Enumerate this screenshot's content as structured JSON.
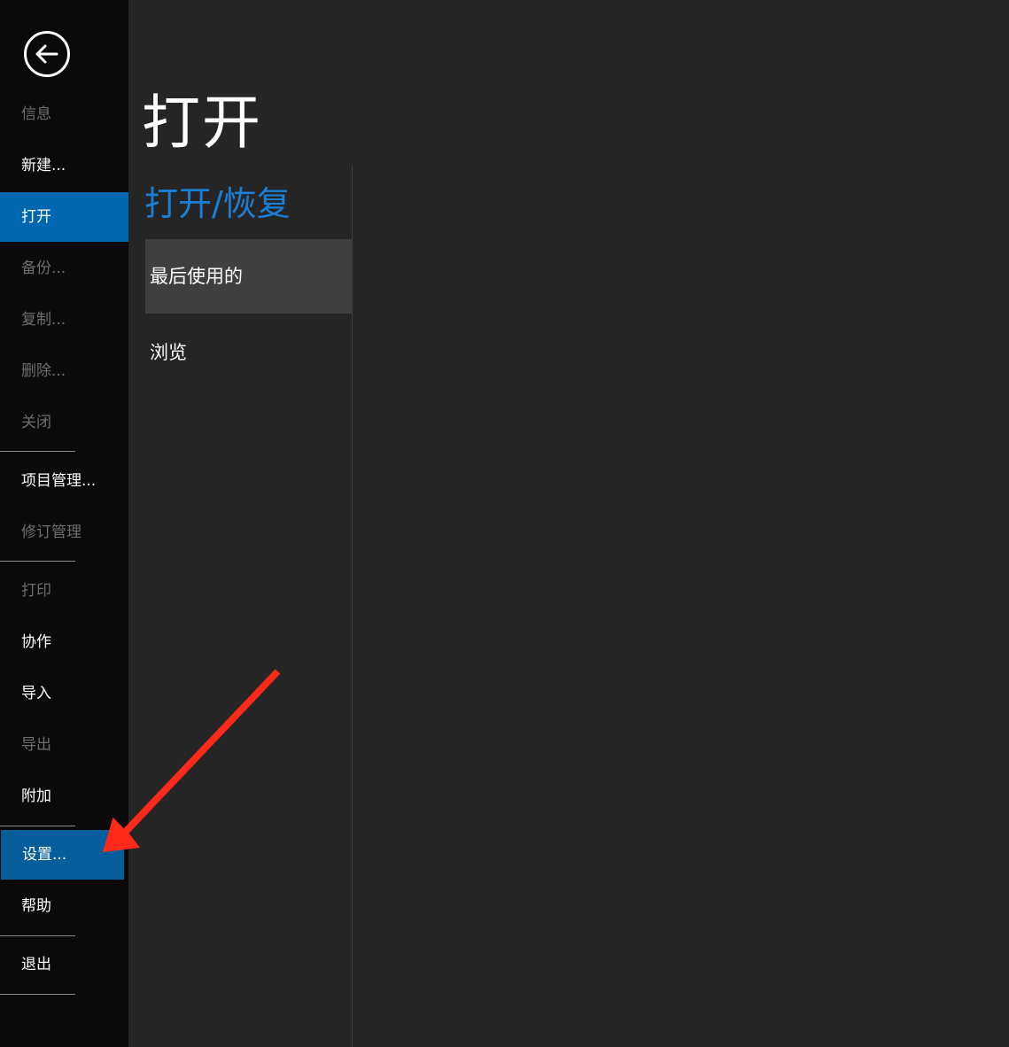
{
  "page_title": "打开",
  "section_title": "打开/恢复",
  "nav": {
    "back_label": "back",
    "items": [
      {
        "label": "信息",
        "state": "disabled"
      },
      {
        "label": "新建...",
        "state": "normal"
      },
      {
        "label": "打开",
        "state": "active"
      },
      {
        "label": "备份...",
        "state": "disabled"
      },
      {
        "label": "复制...",
        "state": "disabled"
      },
      {
        "label": "删除...",
        "state": "disabled"
      },
      {
        "label": "关闭",
        "state": "disabled"
      },
      {
        "label": "项目管理...",
        "state": "normal"
      },
      {
        "label": "修订管理",
        "state": "disabled"
      },
      {
        "label": "打印",
        "state": "disabled"
      },
      {
        "label": "协作",
        "state": "normal"
      },
      {
        "label": "导入",
        "state": "normal"
      },
      {
        "label": "导出",
        "state": "disabled"
      },
      {
        "label": "附加",
        "state": "normal"
      },
      {
        "label": "设置...",
        "state": "highlighted"
      },
      {
        "label": "帮助",
        "state": "normal"
      },
      {
        "label": "退出",
        "state": "normal"
      }
    ]
  },
  "open_options": [
    {
      "label": "最后使用的",
      "selected": true
    },
    {
      "label": "浏览",
      "selected": false
    }
  ],
  "colors": {
    "nav_bg": "#0a0a0a",
    "main_bg": "#252525",
    "accent": "#0067b0",
    "section_title": "#1a7fd6",
    "annotation_arrow": "#ff2a1a"
  }
}
